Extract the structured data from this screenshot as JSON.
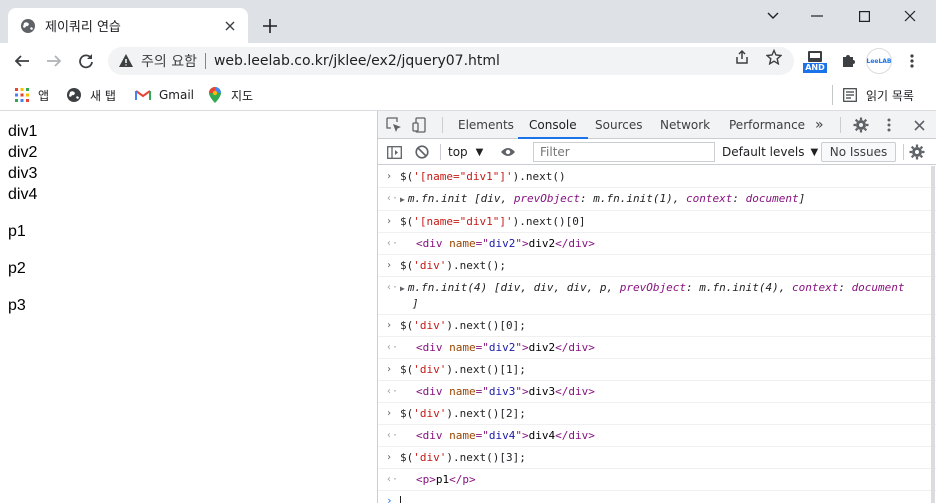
{
  "tab": {
    "title": "제이쿼리 연습"
  },
  "toolbar": {
    "security_text": "주의 요함",
    "url": "web.leelab.co.kr/jklee/ex2/jquery07.html",
    "ext_badge": "AND",
    "profile_label": "LeeLAB"
  },
  "bookmarks": {
    "items": [
      {
        "label": "앱",
        "icon": "apps-grid-icon"
      },
      {
        "label": "새 탭",
        "icon": "globe-icon"
      },
      {
        "label": "Gmail",
        "icon": "gmail-icon"
      },
      {
        "label": "지도",
        "icon": "maps-pin-icon"
      }
    ],
    "reading_list": "읽기 목록"
  },
  "page": {
    "divs": [
      "div1",
      "div2",
      "div3",
      "div4"
    ],
    "ps": [
      "p1",
      "p2",
      "p3"
    ]
  },
  "devtools": {
    "tabs": [
      "Elements",
      "Console",
      "Sources",
      "Network",
      "Performance"
    ],
    "active_tab": "Console",
    "more": "»",
    "context": "top",
    "filter_placeholder": "Filter",
    "levels": "Default levels",
    "issues": "No Issues",
    "accent": "#1a73e8"
  },
  "console": {
    "entries": [
      {
        "kind": "input",
        "parts": [
          [
            "plain",
            "$("
          ],
          [
            "str",
            "'[name=\"div1\"]'"
          ],
          [
            "plain",
            ").next()"
          ]
        ]
      },
      {
        "kind": "result",
        "expand": true,
        "parts": [
          [
            "ital",
            "m.fn.init "
          ],
          [
            "ital",
            "[div, "
          ],
          [
            "key",
            "prevObject"
          ],
          [
            "ital",
            ": m.fn.init(1), "
          ],
          [
            "key",
            "context"
          ],
          [
            "ital",
            ": "
          ],
          [
            "key",
            "document"
          ],
          [
            "ital",
            "]"
          ]
        ]
      },
      {
        "kind": "input",
        "parts": [
          [
            "plain",
            "$("
          ],
          [
            "str",
            "'[name=\"div1\"]'"
          ],
          [
            "plain",
            ").next()[0]"
          ]
        ]
      },
      {
        "kind": "result",
        "el": true,
        "parts": [
          [
            "tag",
            "<div "
          ],
          [
            "attr",
            "name"
          ],
          [
            "tag",
            "=\""
          ],
          [
            "aval",
            "div2"
          ],
          [
            "tag",
            "\">"
          ],
          [
            "plain",
            "div2"
          ],
          [
            "tag",
            "</div>"
          ]
        ]
      },
      {
        "kind": "input",
        "parts": [
          [
            "plain",
            "$("
          ],
          [
            "str",
            "'div'"
          ],
          [
            "plain",
            ").next();"
          ]
        ]
      },
      {
        "kind": "result",
        "expand": true,
        "wrap": true,
        "parts": [
          [
            "ital",
            "m.fn.init(4) [div, div, div, p, "
          ],
          [
            "key",
            "prevObject"
          ],
          [
            "ital",
            ": m.fn.init(4), "
          ],
          [
            "key",
            "context"
          ],
          [
            "ital",
            ": "
          ],
          [
            "key",
            "document"
          ]
        ],
        "wrap_text": "]"
      },
      {
        "kind": "input",
        "parts": [
          [
            "plain",
            "$("
          ],
          [
            "str",
            "'div'"
          ],
          [
            "plain",
            ").next()[0];"
          ]
        ]
      },
      {
        "kind": "result",
        "el": true,
        "parts": [
          [
            "tag",
            "<div "
          ],
          [
            "attr",
            "name"
          ],
          [
            "tag",
            "=\""
          ],
          [
            "aval",
            "div2"
          ],
          [
            "tag",
            "\">"
          ],
          [
            "plain",
            "div2"
          ],
          [
            "tag",
            "</div>"
          ]
        ]
      },
      {
        "kind": "input",
        "parts": [
          [
            "plain",
            "$("
          ],
          [
            "str",
            "'div'"
          ],
          [
            "plain",
            ").next()[1];"
          ]
        ]
      },
      {
        "kind": "result",
        "el": true,
        "parts": [
          [
            "tag",
            "<div "
          ],
          [
            "attr",
            "name"
          ],
          [
            "tag",
            "=\""
          ],
          [
            "aval",
            "div3"
          ],
          [
            "tag",
            "\">"
          ],
          [
            "plain",
            "div3"
          ],
          [
            "tag",
            "</div>"
          ]
        ]
      },
      {
        "kind": "input",
        "parts": [
          [
            "plain",
            "$("
          ],
          [
            "str",
            "'div'"
          ],
          [
            "plain",
            ").next()[2];"
          ]
        ]
      },
      {
        "kind": "result",
        "el": true,
        "parts": [
          [
            "tag",
            "<div "
          ],
          [
            "attr",
            "name"
          ],
          [
            "tag",
            "=\""
          ],
          [
            "aval",
            "div4"
          ],
          [
            "tag",
            "\">"
          ],
          [
            "plain",
            "div4"
          ],
          [
            "tag",
            "</div>"
          ]
        ]
      },
      {
        "kind": "input",
        "parts": [
          [
            "plain",
            "$("
          ],
          [
            "str",
            "'div'"
          ],
          [
            "plain",
            ").next()[3];"
          ]
        ]
      },
      {
        "kind": "result",
        "el": true,
        "parts": [
          [
            "tag",
            "<p>"
          ],
          [
            "plain",
            "p1"
          ],
          [
            "tag",
            "</p>"
          ]
        ]
      }
    ]
  }
}
